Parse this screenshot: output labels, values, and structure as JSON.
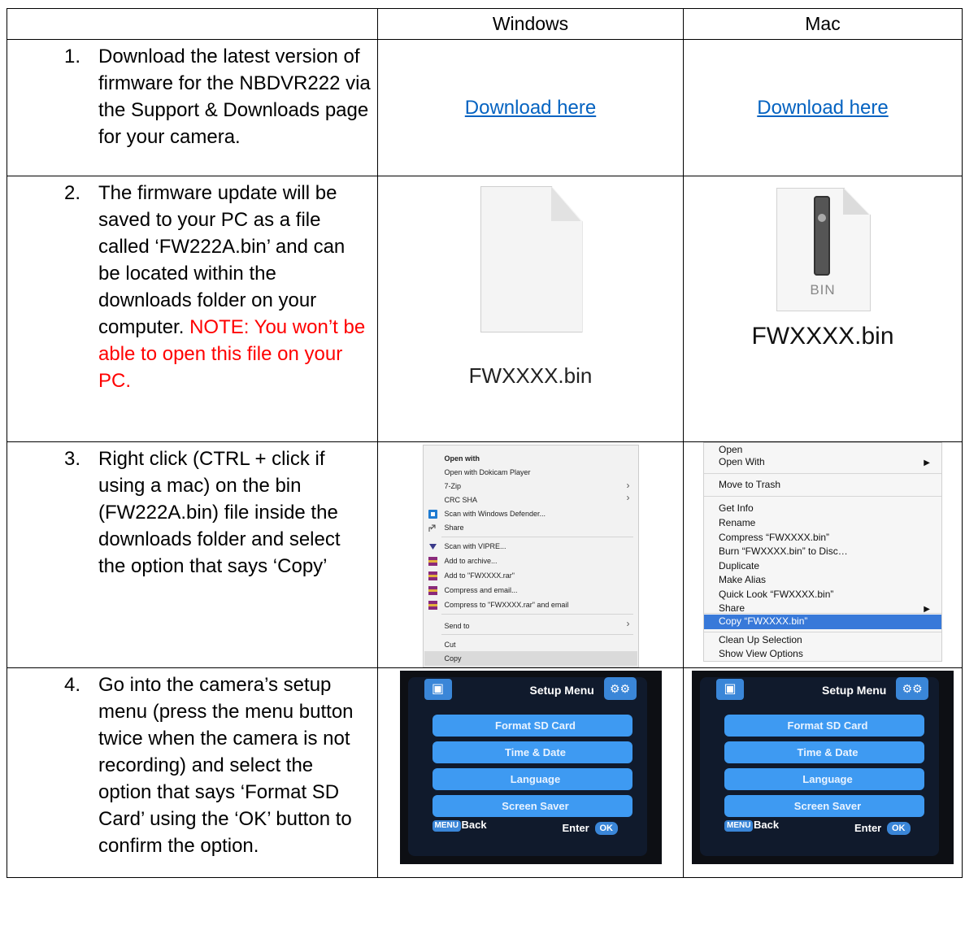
{
  "header": {
    "col1": "",
    "col2": "Windows",
    "col3": "Mac"
  },
  "steps": [
    {
      "num": "1.",
      "text": "Download the latest version of firmware for the NBDVR222 via the Support & Downloads page for your camera."
    },
    {
      "num": "2.",
      "text": "The firmware update will be saved to your PC as a file called ‘FW222A.bin’ and can be located within the downloads folder on your computer.",
      "note": "NOTE: You won’t be able to open this file on your PC."
    },
    {
      "num": "3.",
      "text": "Right click (CTRL + click if using a mac) on the bin (FW222A.bin) file inside the downloads folder and select the option that says ‘Copy’"
    },
    {
      "num": "4.",
      "text": "Go into the camera’s setup menu (press the menu button twice when the camera is not recording) and select the option that says ‘Format SD Card’ using the ‘OK’ button to confirm the option."
    }
  ],
  "links": {
    "windows": "Download here",
    "mac": "Download here"
  },
  "files": {
    "windows_name": "FWXXXX.bin",
    "mac_name": "FWXXXX.bin",
    "mac_icon_label": "BIN"
  },
  "win_menu": {
    "items": [
      "Open with",
      "Open with Dokicam Player",
      "7-Zip",
      "CRC SHA",
      "Scan with Windows Defender...",
      "Share",
      "Scan with VIPRE...",
      "Add to archive...",
      "Add to \"FWXXXX.rar\"",
      "Compress and email...",
      "Compress to \"FWXXXX.rar\" and email",
      "Send to",
      "Cut",
      "Copy"
    ]
  },
  "mac_menu": {
    "items": [
      "Open",
      "Open With",
      "Move to Trash",
      "Get Info",
      "Rename",
      "Compress “FWXXXX.bin”",
      "Burn “FWXXXX.bin” to Disc…",
      "Duplicate",
      "Make Alias",
      "Quick Look “FWXXXX.bin”",
      "Share",
      "Copy “FWXXXX.bin”",
      "Clean Up Selection",
      "Show View Options"
    ]
  },
  "camera": {
    "title": "Setup Menu",
    "options": [
      "Format SD Card",
      "Time & Date",
      "Language",
      "Screen Saver"
    ],
    "menu_key": "MENU",
    "back": "Back",
    "enter": "Enter",
    "ok_key": "OK"
  },
  "colors": {
    "link": "#0563c1",
    "note": "#ff0000",
    "mac_highlight": "#3879d9",
    "camera_option": "#3e9af2"
  }
}
